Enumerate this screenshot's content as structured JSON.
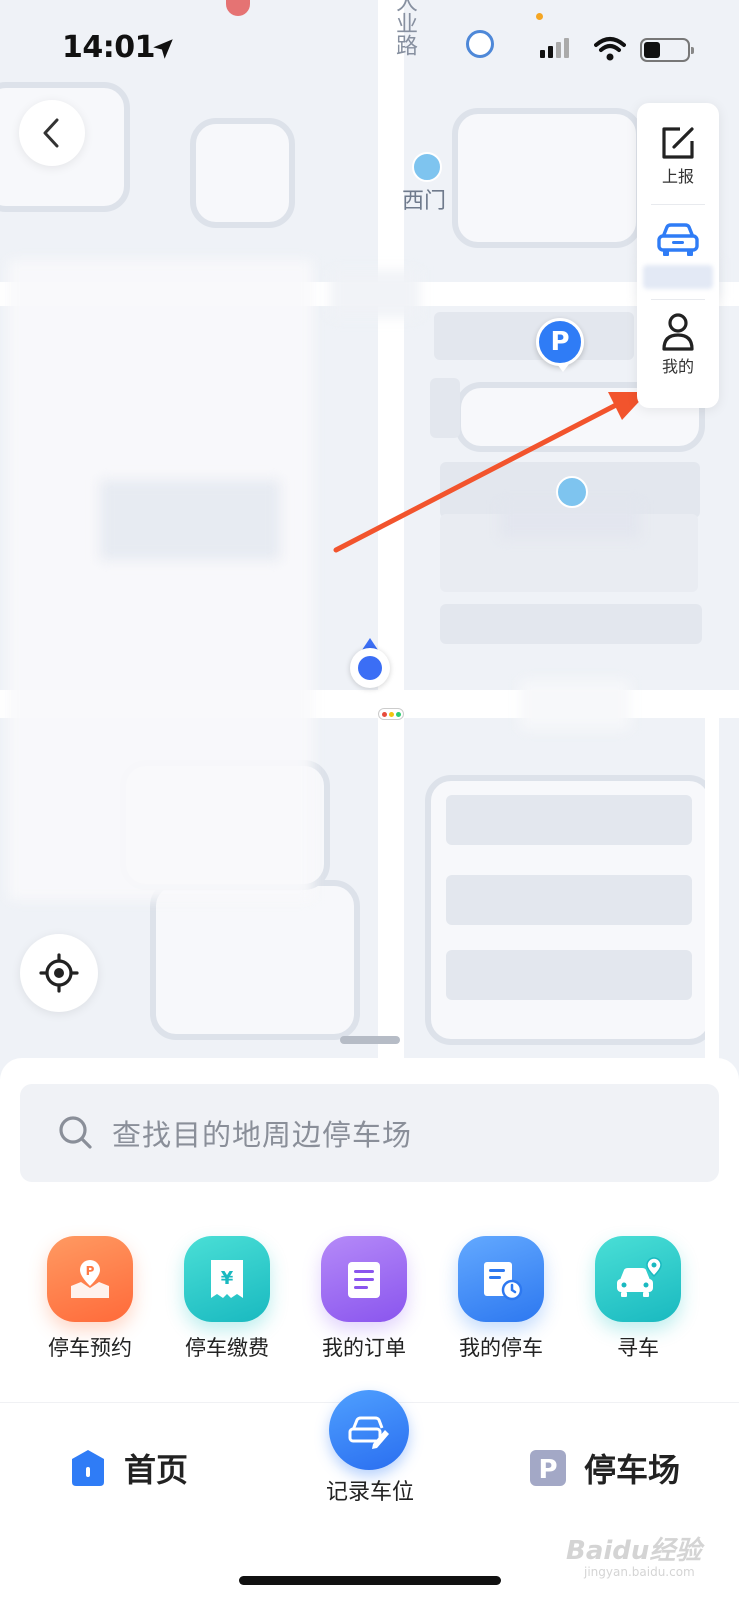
{
  "status_bar": {
    "time": "14:01"
  },
  "map": {
    "labels": {
      "west_gate": "西门",
      "road_name": "大业路"
    }
  },
  "right_panel": {
    "report_label": "上报",
    "mine_label": "我的"
  },
  "parking_pin": {
    "label": "P"
  },
  "search": {
    "placeholder": "查找目的地周边停车场"
  },
  "quick_actions": [
    {
      "label": "停车预约",
      "icon": "parking-reservation-icon",
      "color": "#ff7a45"
    },
    {
      "label": "停车缴费",
      "icon": "parking-payment-icon",
      "color": "#26c6c6"
    },
    {
      "label": "我的订单",
      "icon": "my-orders-icon",
      "color": "#9b6cf5"
    },
    {
      "label": "我的停车",
      "icon": "my-parking-icon",
      "color": "#3d8bf6"
    },
    {
      "label": "寻车",
      "icon": "find-car-icon",
      "color": "#26c6c6"
    }
  ],
  "bottom_nav": {
    "home_label": "首页",
    "record_label": "记录车位",
    "parking_label": "停车场"
  },
  "watermark": {
    "text": "Baidu经验",
    "sub": "jingyan.baidu.com"
  }
}
